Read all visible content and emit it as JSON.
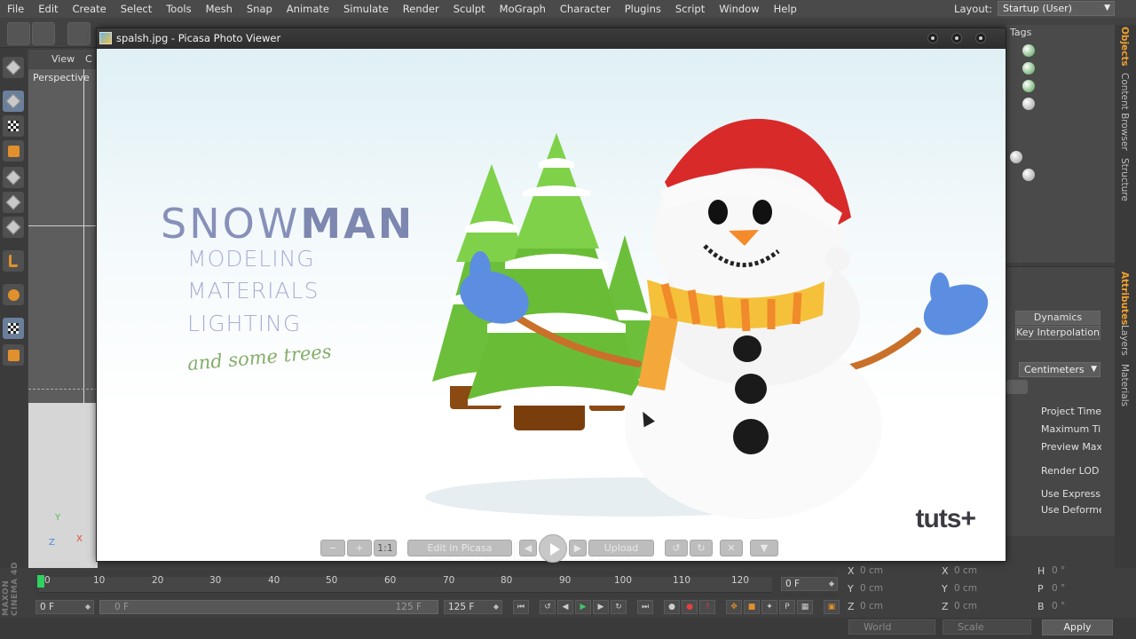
{
  "menubar": {
    "items": [
      "File",
      "Edit",
      "Create",
      "Select",
      "Tools",
      "Mesh",
      "Snap",
      "Animate",
      "Simulate",
      "Render",
      "Sculpt",
      "MoGraph",
      "Character",
      "Plugins",
      "Script",
      "Window",
      "Help"
    ],
    "layout_label": "Layout:",
    "layout_value": "Startup (User)"
  },
  "viewport": {
    "menu_view": "View",
    "menu_cut": "C",
    "label": "Perspective",
    "axis_x": "X",
    "axis_y": "Y",
    "axis_z": "Z"
  },
  "objects": {
    "tags_tab": "Tags"
  },
  "side_tabs": [
    "Objects",
    "Content Browser",
    "Structure",
    "Attributes",
    "Layers",
    "Materials"
  ],
  "attributes": {
    "dynamics": "Dynamics",
    "key_interpolation": "Key Interpolation",
    "units_value": "Centimeters",
    "labels": [
      "Project Time.",
      "Maximum Tir",
      "Preview Max",
      "Render LOD i",
      "Use Expressi",
      "Use Deforme"
    ]
  },
  "picasa": {
    "title": "spalsh.jpg - Picasa Photo Viewer",
    "photo": {
      "title_light": "SNOW",
      "title_bold": "MAN",
      "lines": [
        "MODELING",
        "MATERIALS",
        "LIGHTING"
      ],
      "script": "and some trees",
      "brand": "tuts+"
    },
    "controls": {
      "one_to_one": "1:1",
      "edit": "Edit in Picasa",
      "upload": "Upload"
    }
  },
  "timeline": {
    "ticks": [
      "0",
      "10",
      "20",
      "30",
      "40",
      "50",
      "60",
      "70",
      "80",
      "90",
      "100",
      "110",
      "120"
    ],
    "current_frame": "0 F",
    "start_frame": "0 F",
    "range_start": "0 F",
    "range_end": "125 F",
    "end_frame": "125 F"
  },
  "coords": {
    "rows": [
      {
        "a": "X",
        "av": "0 cm",
        "b": "X",
        "bv": "0 cm",
        "c": "H",
        "cv": "0 °"
      },
      {
        "a": "Y",
        "av": "0 cm",
        "b": "Y",
        "bv": "0 cm",
        "c": "P",
        "cv": "0 °"
      },
      {
        "a": "Z",
        "av": "0 cm",
        "b": "Z",
        "bv": "0 cm",
        "c": "B",
        "cv": "0 °"
      }
    ],
    "world": "World",
    "scale": "Scale",
    "apply": "Apply"
  },
  "brand_vertical": "MAXON CINEMA 4D",
  "colors": {
    "accent_orange": "#f0a030",
    "timeline_cursor": "#2fd15f",
    "snow_title": "#8790b8",
    "script_green": "#86ac6a"
  }
}
